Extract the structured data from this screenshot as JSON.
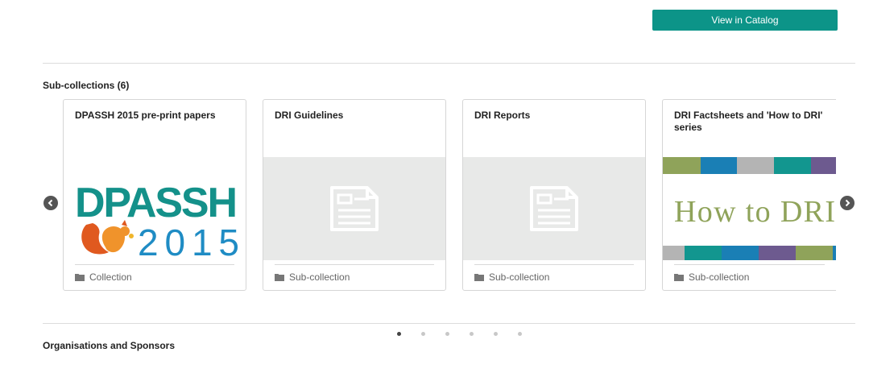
{
  "header": {
    "catalog_button_label": "View in Catalog"
  },
  "subcollections": {
    "heading": "Sub-collections (6)",
    "cards": [
      {
        "title": "DPASSH 2015 pre-print papers",
        "type": "Collection",
        "image": "dpassh-logo",
        "logo_text": "DPASSH",
        "logo_year": "2015"
      },
      {
        "title": "DRI Guidelines",
        "type": "Sub-collection",
        "image": "document-placeholder-icon"
      },
      {
        "title": "DRI Reports",
        "type": "Sub-collection",
        "image": "document-placeholder-icon"
      },
      {
        "title": "DRI Factsheets and 'How to DRI' series",
        "type": "Sub-collection",
        "image": "how-to-dri-banner",
        "banner_text": "How to DRI"
      }
    ],
    "carousel": {
      "page_count": 6,
      "active_page": 1
    }
  },
  "organisations": {
    "heading": "Organisations and Sponsors"
  },
  "colors": {
    "accent": "#0c9488",
    "banner_stripes": [
      "#8fa35a",
      "#1a7fb5",
      "#b4b4b4",
      "#12968f",
      "#6d5a8f"
    ]
  }
}
